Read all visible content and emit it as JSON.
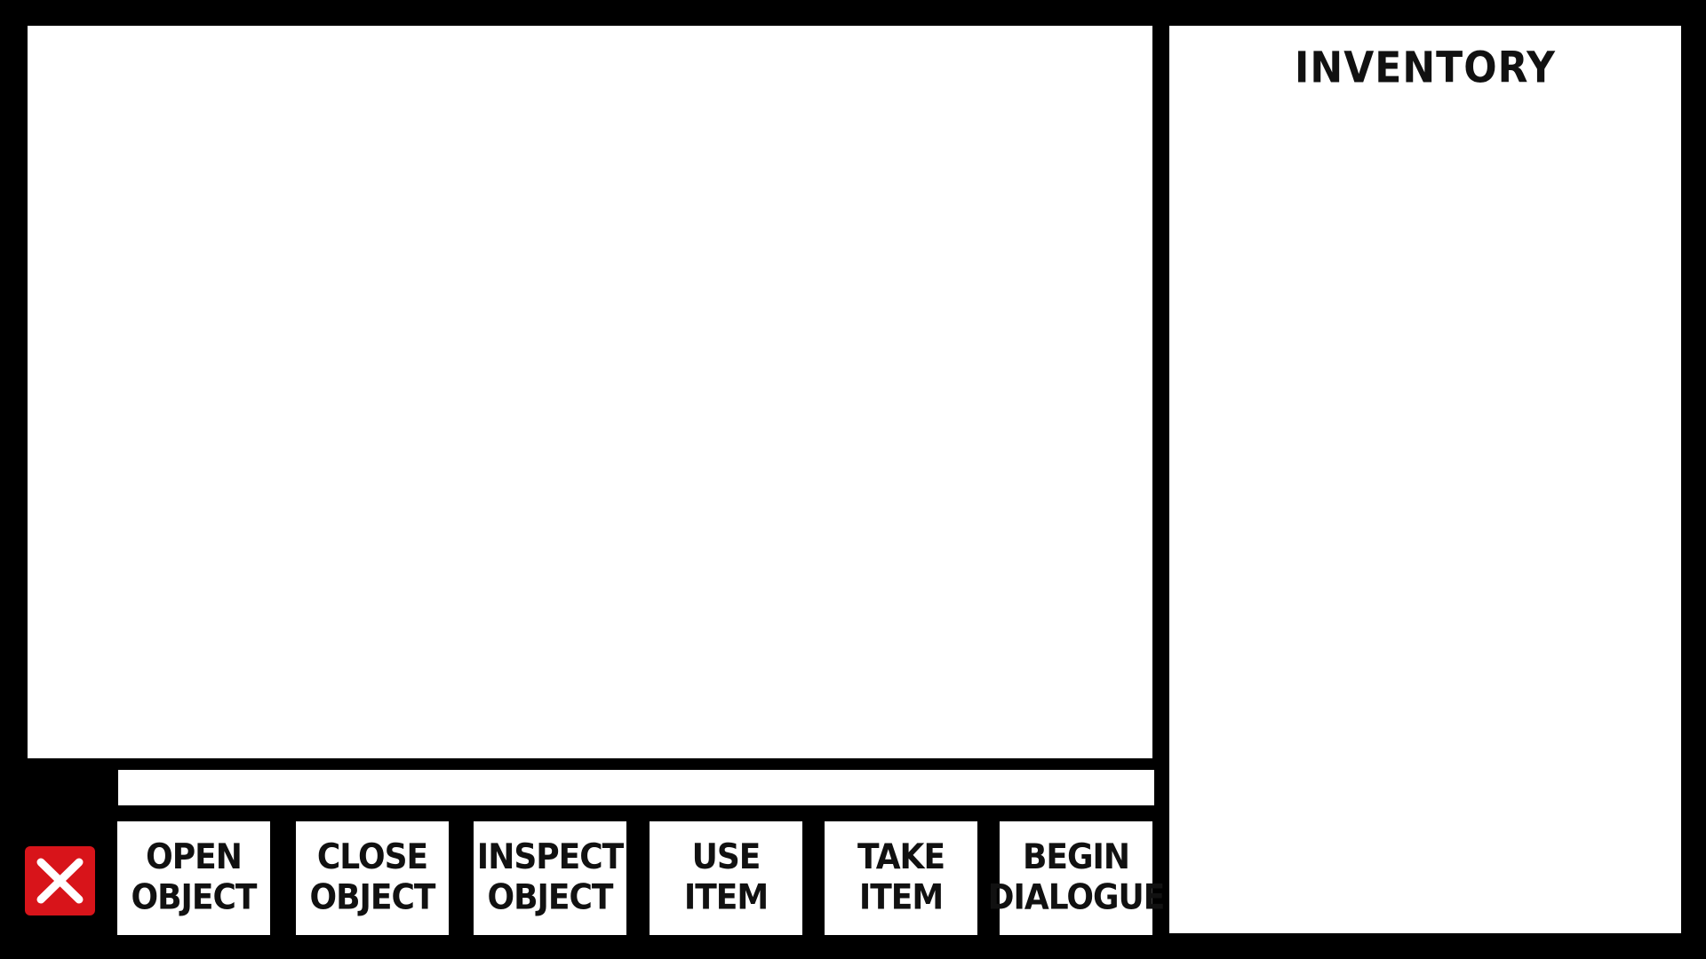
{
  "inventory": {
    "title": "INVENTORY",
    "items": []
  },
  "command_line": {
    "value": "",
    "placeholder": ""
  },
  "close_button": {
    "icon": "close-x-icon",
    "color": "#d8141a"
  },
  "verbs": [
    {
      "label": "OPEN\nOBJECT"
    },
    {
      "label": "CLOSE\nOBJECT"
    },
    {
      "label": "INSPECT\nOBJECT"
    },
    {
      "label": "USE\nITEM"
    },
    {
      "label": "TAKE\nITEM"
    },
    {
      "label": "BEGIN\nDIALOGUE"
    }
  ]
}
